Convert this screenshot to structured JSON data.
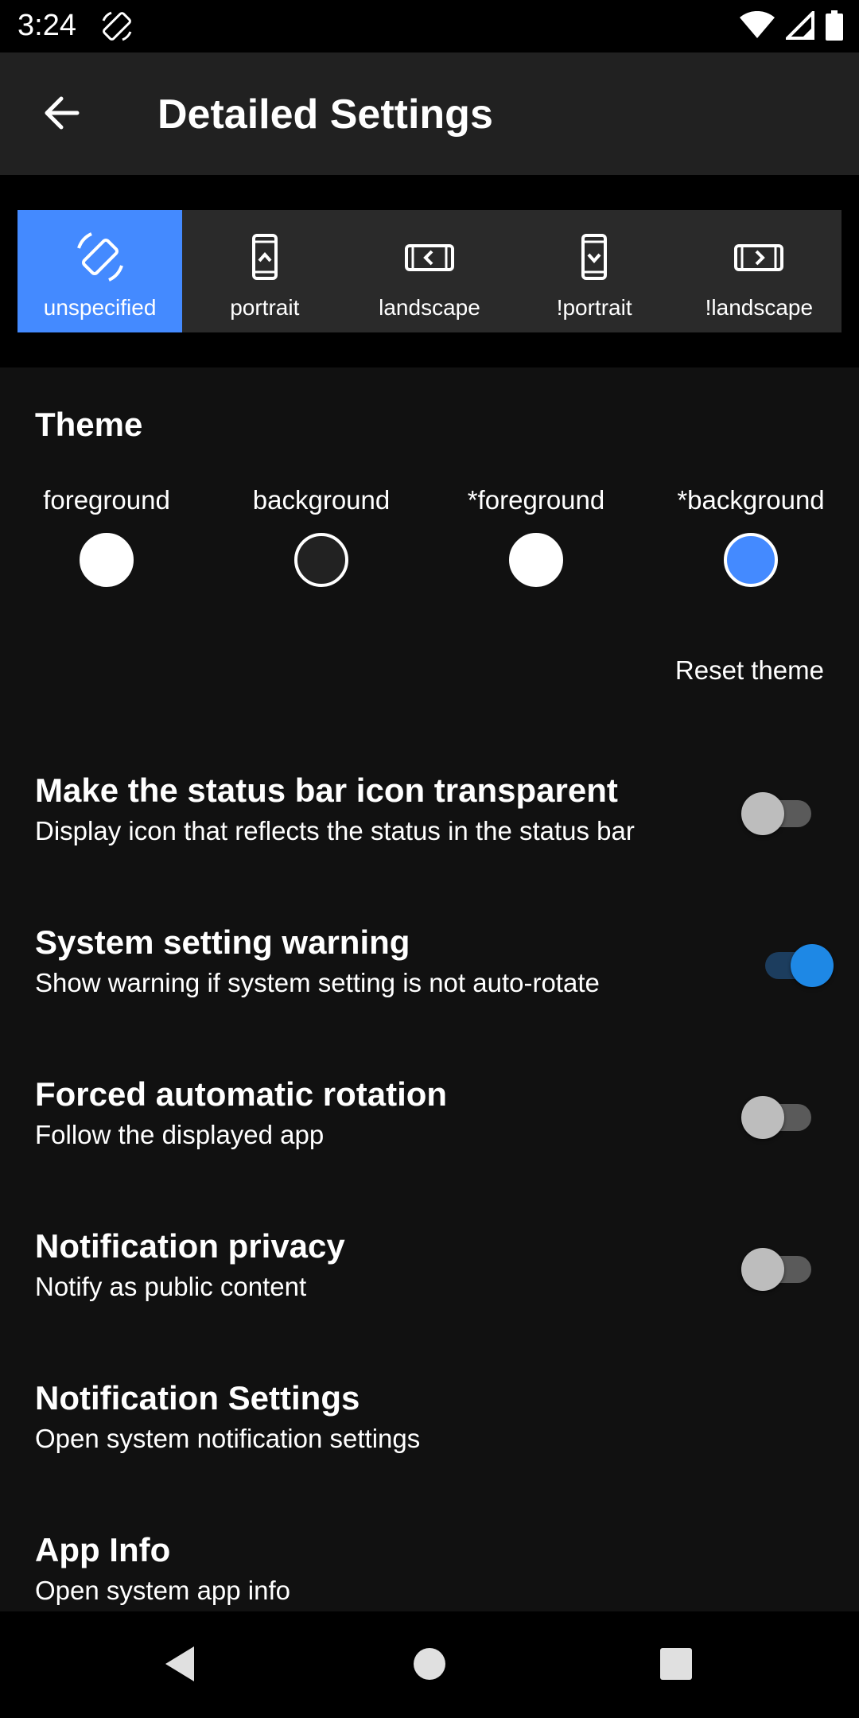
{
  "status_bar": {
    "time": "3:24",
    "icons": [
      "auto-rotate-icon",
      "wifi-icon",
      "signal-icon",
      "battery-icon"
    ]
  },
  "app_bar": {
    "back_icon": "arrow-back-icon",
    "title": "Detailed Settings"
  },
  "orientation": {
    "selected": "unspecified",
    "options": [
      {
        "label": "unspecified",
        "icon": "screen-rotation-icon"
      },
      {
        "label": "portrait",
        "icon": "portrait-icon"
      },
      {
        "label": "landscape",
        "icon": "landscape-icon"
      },
      {
        "label": "!portrait",
        "icon": "reverse-portrait-icon"
      },
      {
        "label": "!landscape",
        "icon": "reverse-landscape-icon"
      }
    ],
    "accent_color": "#448aff"
  },
  "theme": {
    "title": "Theme",
    "swatches": [
      {
        "label": "foreground",
        "color": "#ffffff"
      },
      {
        "label": "background",
        "color": "#222222"
      },
      {
        "label": "*foreground",
        "color": "#ffffff"
      },
      {
        "label": "*background",
        "color": "#448aff"
      }
    ],
    "reset_label": "Reset theme"
  },
  "settings": [
    {
      "title": "Make the status bar icon transparent",
      "subtitle": "Display icon that reflects the status in the status bar",
      "toggle": false
    },
    {
      "title": "System setting warning",
      "subtitle": "Show warning if system setting is not auto-rotate",
      "toggle": true
    },
    {
      "title": "Forced automatic rotation",
      "subtitle": "Follow the displayed app",
      "toggle": false
    },
    {
      "title": "Notification privacy",
      "subtitle": "Notify as public content",
      "toggle": false
    },
    {
      "title": "Notification Settings",
      "subtitle": "Open system notification settings"
    },
    {
      "title": "App Info",
      "subtitle": "Open system app info"
    }
  ],
  "nav_bar": {
    "icons": [
      "nav-back-icon",
      "nav-home-icon",
      "nav-recents-icon"
    ]
  }
}
